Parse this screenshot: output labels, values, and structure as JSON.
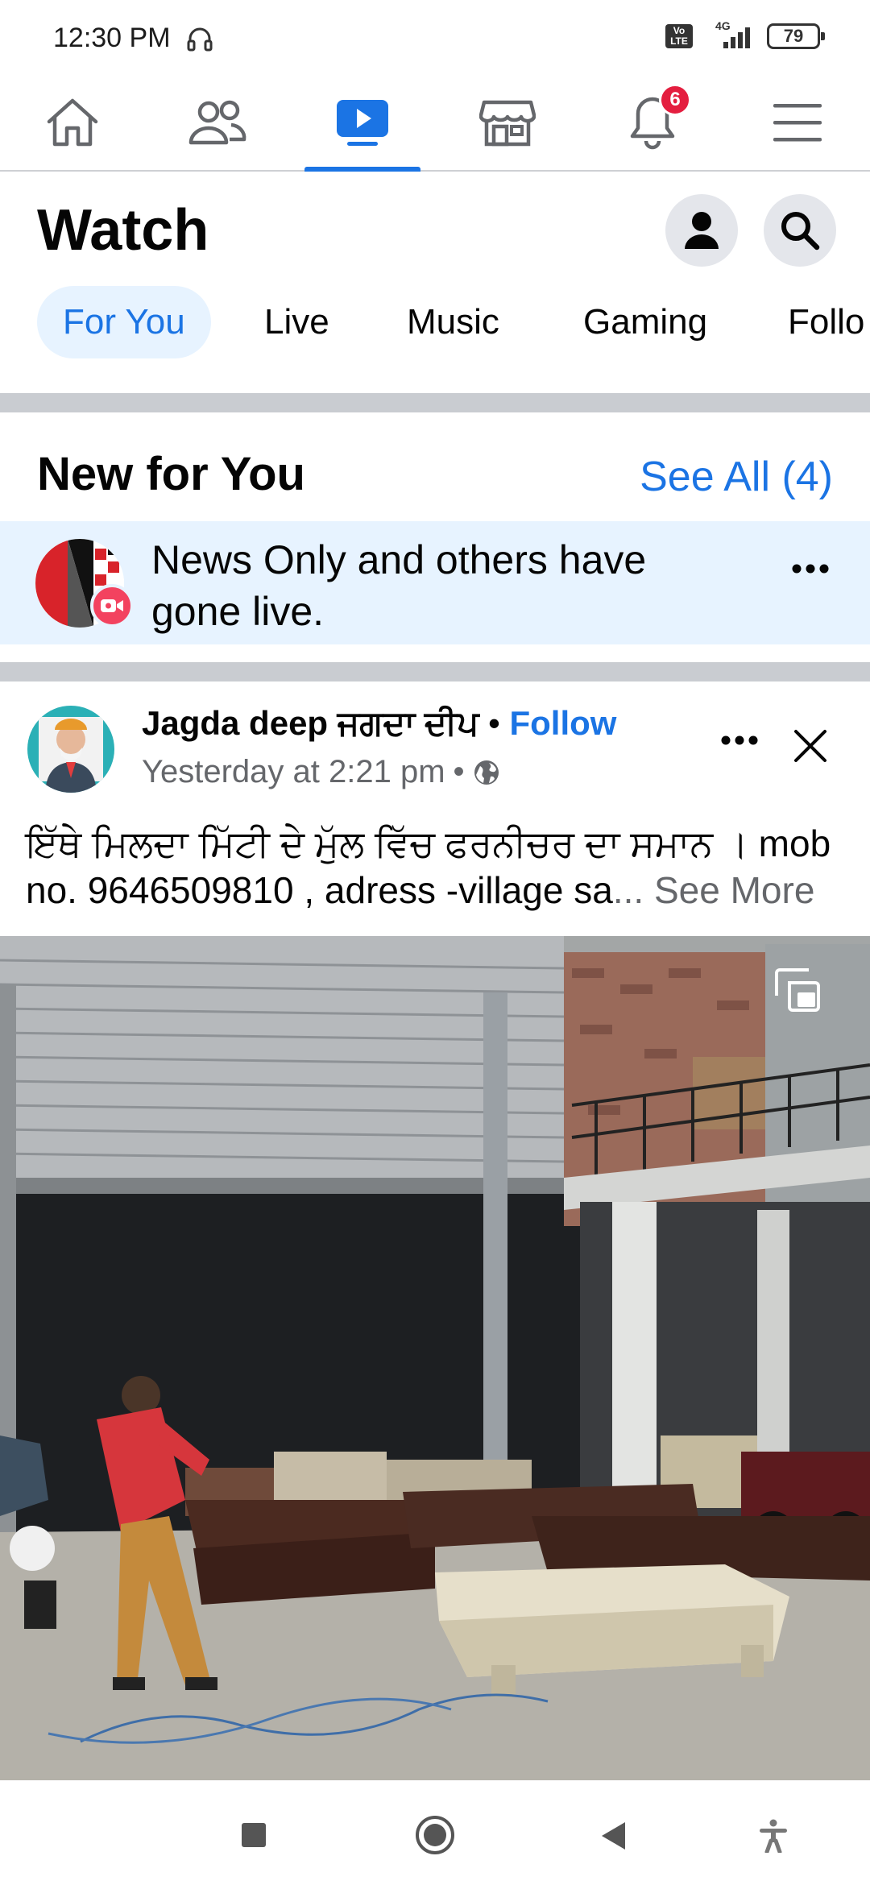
{
  "status_bar": {
    "time": "12:30 PM",
    "network": "4G",
    "volte": "Vo LTE",
    "battery": "79"
  },
  "top_nav": {
    "items": [
      {
        "name": "home",
        "icon": "home-icon"
      },
      {
        "name": "friends",
        "icon": "friends-icon"
      },
      {
        "name": "watch",
        "icon": "watch-icon",
        "active": true
      },
      {
        "name": "marketplace",
        "icon": "marketplace-icon"
      },
      {
        "name": "notifications",
        "icon": "bell-icon",
        "badge": "6"
      },
      {
        "name": "menu",
        "icon": "menu-icon"
      }
    ],
    "accent": "#1b74e4",
    "badge_color": "#e41e3f"
  },
  "header": {
    "title": "Watch",
    "profile_icon": "person-icon",
    "search_icon": "search-icon"
  },
  "tabs": [
    "For You",
    "Live",
    "Music",
    "Gaming",
    "Follo"
  ],
  "new_for_you": {
    "title": "New for You",
    "see_all": "See All (4)",
    "notification_text": "News Only and others have gone live.",
    "more_icon": "more-icon"
  },
  "post": {
    "author": "Jagda deep ਜਗਦਾ ਦੀਪ",
    "separator": " • ",
    "follow": "Follow",
    "time": "Yesterday at 2:21 pm",
    "time_separator": "•",
    "privacy_icon": "globe-icon",
    "text": "ਇੱਥੇ ਮਿਲਦਾ ਮਿੱਟੀ ਦੇ ਮੁੱਲ ਵਿੱਚ ਫਰਨੀਚਰ ਦਾ ਸਮਾਨ । mob no. 9646509810 , adress -village sa",
    "ellipsis": "... ",
    "see_more": "See More"
  },
  "android_nav": {
    "items": [
      "recents-icon",
      "home-circle-icon",
      "back-icon",
      "accessibility-icon"
    ]
  }
}
